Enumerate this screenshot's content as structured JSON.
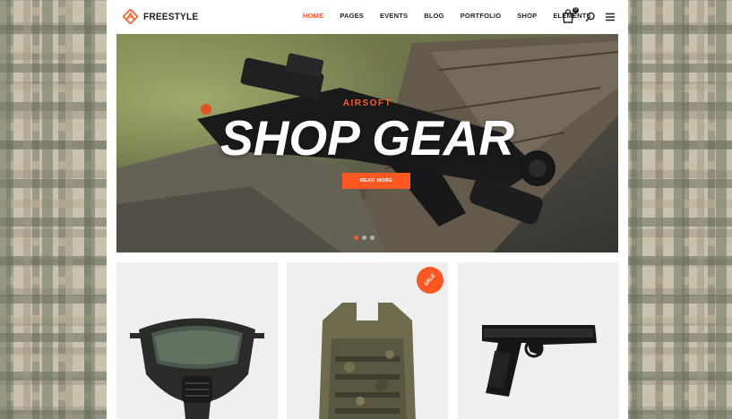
{
  "brand": {
    "name": "FREESTYLE",
    "accent_color": "#ff5722"
  },
  "nav": {
    "items": [
      {
        "label": "HOME",
        "active": true
      },
      {
        "label": "PAGES",
        "active": false
      },
      {
        "label": "EVENTS",
        "active": false
      },
      {
        "label": "BLOG",
        "active": false
      },
      {
        "label": "PORTFOLIO",
        "active": false
      },
      {
        "label": "SHOP",
        "active": false
      },
      {
        "label": "ELEMENTS",
        "active": false
      }
    ],
    "icons": [
      "cart-icon",
      "search-icon",
      "menu-icon"
    ],
    "cart_count": "0"
  },
  "hero": {
    "kicker": "AIRSOFT",
    "title": "SHOP GEAR",
    "button_label": "READ MORE",
    "slides": 3,
    "active_slide": 1
  },
  "products": [
    {
      "image": "mask-icon",
      "sale": false
    },
    {
      "image": "tactical-vest-icon",
      "sale": true,
      "badge": "SALE"
    },
    {
      "image": "pistol-icon",
      "sale": false
    }
  ]
}
